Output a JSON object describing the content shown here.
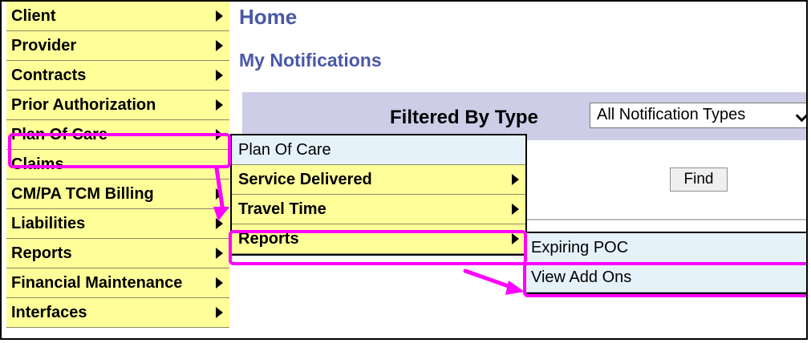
{
  "main_menu": [
    {
      "label": "Client",
      "has_submenu": true
    },
    {
      "label": "Provider",
      "has_submenu": true
    },
    {
      "label": "Contracts",
      "has_submenu": true
    },
    {
      "label": "Prior Authorization",
      "has_submenu": true
    },
    {
      "label": "Plan Of Care",
      "has_submenu": true
    },
    {
      "label": "Claims",
      "has_submenu": false
    },
    {
      "label": "CM/PA TCM Billing",
      "has_submenu": true
    },
    {
      "label": "Liabilities",
      "has_submenu": true
    },
    {
      "label": "Reports",
      "has_submenu": true
    },
    {
      "label": "Financial Maintenance",
      "has_submenu": true
    },
    {
      "label": "Interfaces",
      "has_submenu": true
    }
  ],
  "page": {
    "title": "Home",
    "section_title": "My Notifications",
    "filter_label": "Filtered By Type",
    "filter_selected": "All Notification Types",
    "find_button": "Find"
  },
  "plan_of_care_submenu": [
    {
      "label": "Plan Of Care",
      "has_submenu": false
    },
    {
      "label": "Service Delivered",
      "has_submenu": true
    },
    {
      "label": "Travel Time",
      "has_submenu": true
    },
    {
      "label": "Reports",
      "has_submenu": true
    }
  ],
  "reports_submenu": [
    {
      "label": "Expiring POC"
    },
    {
      "label": "View Add Ons"
    }
  ],
  "colors": {
    "menu_bg": "#ffff99",
    "hover_bg": "#e6f2fa",
    "title_blue": "#4a58a8",
    "filter_bar": "#cdcde8",
    "highlight": "#ff00ff"
  }
}
